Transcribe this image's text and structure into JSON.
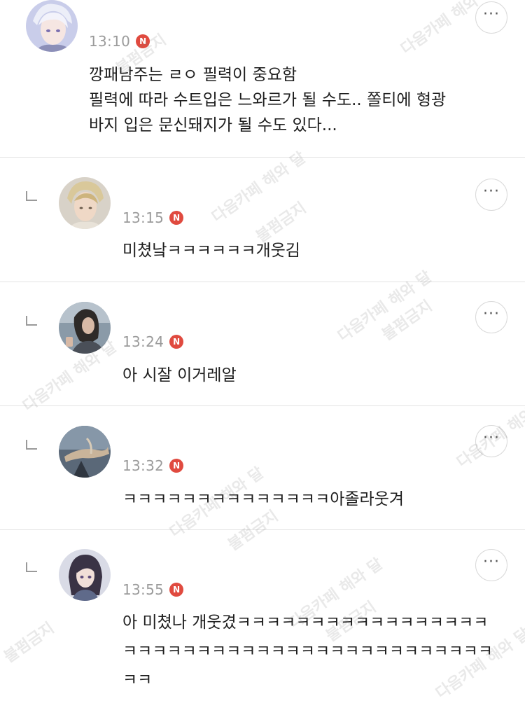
{
  "comments": [
    {
      "time": "13:10",
      "badge": "N",
      "text": "깡패남주는 ㄹㅇ 필력이 중요함\n필력에 따라 수트입은 느와르가 될 수도.. 쫄티에 형광\n바지 입은 문신돼지가 될 수도 있다..."
    },
    {
      "time": "13:15",
      "badge": "N",
      "text": "미쳤낰ㅋㅋㅋㅋㅋㅋ개웃김"
    },
    {
      "time": "13:24",
      "badge": "N",
      "text": "아 시잘 이거레알"
    },
    {
      "time": "13:32",
      "badge": "N",
      "text": "ㅋㅋㅋㅋㅋㅋㅋㅋㅋㅋㅋㅋㅋㅋ아졸라웃겨"
    },
    {
      "time": "13:55",
      "badge": "N",
      "text": "아 미쳤나 개웃겼ㅋㅋㅋㅋㅋㅋㅋㅋㅋㅋㅋㅋㅋㅋㅋㅋㅋ\nㅋㅋㅋㅋㅋㅋㅋㅋㅋㅋㅋㅋㅋㅋㅋㅋㅋㅋㅋㅋㅋㅋㅋㅋㅋ\nㅋㅋ"
    }
  ],
  "more_label": "···",
  "watermark": {
    "line1": "다음카페 해와 달",
    "line2": "불펌금지"
  },
  "colors": {
    "badge": "#e04a3f",
    "divider": "#e3e3e3",
    "time": "#9b9b9b"
  }
}
